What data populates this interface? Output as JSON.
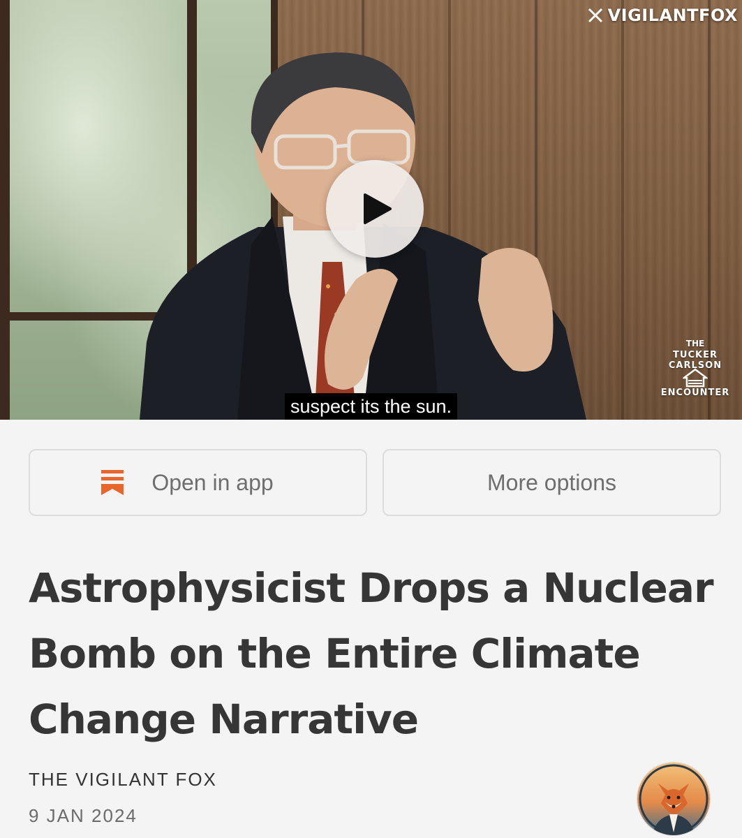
{
  "video": {
    "subtitle": "suspect its the sun.",
    "watermark_handle": "VIGILANTFOX",
    "watermark_icon": "x-logo-icon",
    "show_logo_lines": [
      "THE",
      "TUCKER CARLSON",
      "ENCOUNTER"
    ],
    "play_icon": "play-icon"
  },
  "actions": {
    "open_in_app": "Open in app",
    "open_in_app_icon": "bookmark-icon",
    "more_options": "More options",
    "accent_color": "#e8652b"
  },
  "article": {
    "title": "Astrophysicist Drops a Nuclear Bomb on the Entire Climate Change Narrative",
    "author": "THE VIGILANT FOX",
    "date": "9 JAN 2024"
  }
}
